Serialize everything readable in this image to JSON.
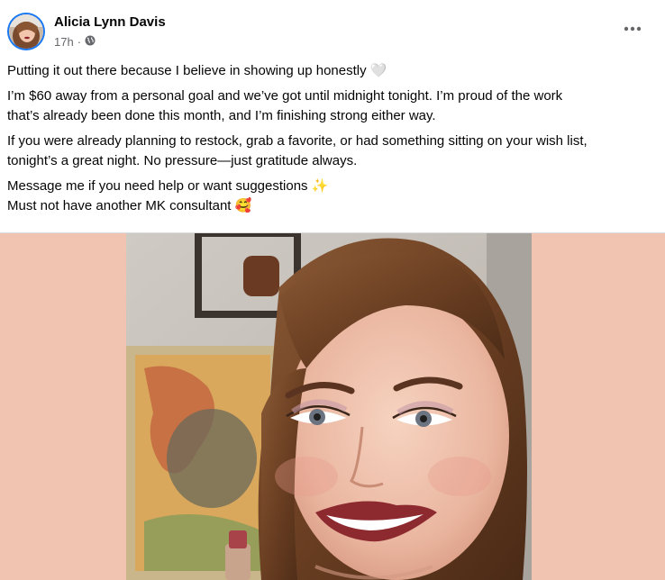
{
  "post": {
    "author": "Alicia Lynn Davis",
    "time": "17h",
    "separator": "·",
    "audience_icon": "globe-icon",
    "more_icon": "more-options-icon",
    "paragraphs": [
      [
        "Putting it out there because I believe in showing up honestly 🤍"
      ],
      [
        "I’m $60 away from a personal goal and we’ve got until midnight tonight. I’m proud of the work",
        "that’s already been done this month, and I’m finishing strong either way."
      ],
      [
        "If you were already planning to restock, grab a favorite, or had something sitting on your wish list,",
        "tonight’s a great night. No pressure—just gratitude always."
      ],
      [
        "Message me if you need help or want suggestions ✨",
        "Must not have another MK consultant 🥰"
      ]
    ]
  },
  "colors": {
    "avatar_ring": "#1877f2",
    "photo_background": "#f0c4b1",
    "meta_text": "#65676b"
  }
}
